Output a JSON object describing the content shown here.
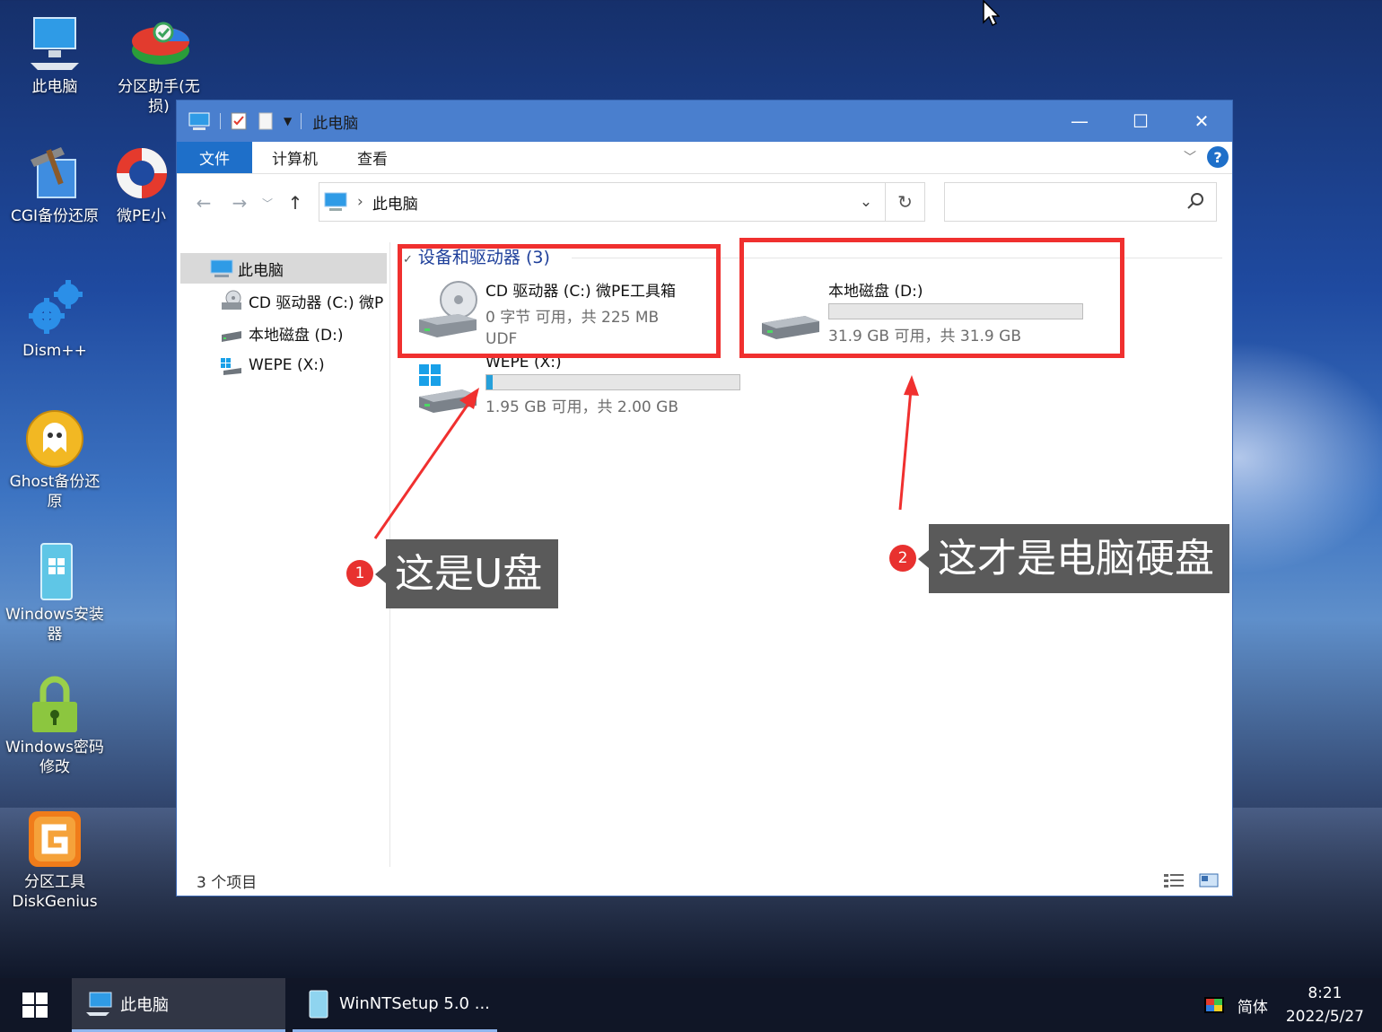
{
  "desktop": {
    "icons": [
      {
        "label": "此电脑",
        "icon": "computer-icon"
      },
      {
        "label": "分区助手(无损)",
        "icon": "partition-assistant-icon"
      },
      {
        "label": "CGI备份还原",
        "icon": "cgi-backup-icon"
      },
      {
        "label": "微PE小",
        "icon": "lifebuoy-icon"
      },
      {
        "label": "Dism++",
        "icon": "gears-icon"
      },
      {
        "label": "Ghost备份还原",
        "icon": "ghost-icon"
      },
      {
        "label": "Windows安装器",
        "icon": "windows-installer-icon"
      },
      {
        "label": "Windows密码修改",
        "icon": "padlock-icon"
      },
      {
        "label": "分区工具DiskGenius",
        "icon": "diskgenius-icon"
      }
    ]
  },
  "window": {
    "title": "此电脑",
    "ribbon_tabs": [
      "文件",
      "计算机",
      "查看"
    ],
    "address": "此电脑",
    "search_placeholder": "",
    "nav_tree": [
      {
        "label": "此电脑",
        "icon": "computer-icon",
        "selected": true
      },
      {
        "label": "CD 驱动器 (C:) 微P",
        "icon": "cd-drive-icon"
      },
      {
        "label": "本地磁盘 (D:)",
        "icon": "hard-drive-icon"
      },
      {
        "label": "WEPE (X:)",
        "icon": "windows-drive-icon"
      }
    ],
    "group_header": "设备和驱动器 (3)",
    "drives": [
      {
        "name": "CD 驱动器 (C:) 微PE工具箱",
        "space": "0 字节 可用，共 225 MB",
        "fs": "UDF",
        "icon": "cd-drive-icon"
      },
      {
        "name": "本地磁盘 (D:)",
        "space": "31.9 GB 可用，共 31.9 GB",
        "used_fraction": 0.0,
        "icon": "hard-drive-icon"
      },
      {
        "name": "WEPE (X:)",
        "space": "1.95 GB 可用，共 2.00 GB",
        "used_fraction": 0.025,
        "icon": "windows-drive-icon"
      }
    ],
    "status_text": "3 个项目"
  },
  "annotations": [
    {
      "number": "1",
      "text": "这是U盘"
    },
    {
      "number": "2",
      "text": "这才是电脑硬盘"
    }
  ],
  "colors": {
    "highlight_red": "#f0302f",
    "titlebar": "#4a7fce",
    "accent": "#1e6fc9",
    "callout_bg": "#5a5a5a"
  },
  "taskbar": {
    "items": [
      {
        "label": "此电脑",
        "icon": "computer-icon"
      },
      {
        "label": "WinNTSetup 5.0 ...",
        "icon": "winntsetup-icon"
      }
    ],
    "ime": "简体",
    "time": "8:21",
    "date": "2022/5/27"
  }
}
